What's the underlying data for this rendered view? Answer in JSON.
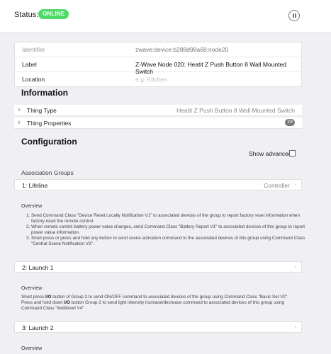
{
  "status": {
    "label": "Status:",
    "badge": "ONLINE",
    "badge_color": "#4cd964"
  },
  "pause_icon": "pause-circle-icon",
  "properties": {
    "identifier_label": "Identifier",
    "identifier_value": "zwave:device:b288d98a68:node20",
    "label_label": "Label",
    "label_value": "Z-Wave Node 020: Heatit Z Push Button 8 Wall Mounted Switch",
    "location_label": "Location",
    "location_placeholder": "e.g. Kitchen"
  },
  "information": {
    "title": "Information",
    "thing_type_label": "Thing Type",
    "thing_type_value": "Heatit Z Push Button 8 Wall Mounted Switch",
    "thing_properties_label": "Thing Properties",
    "thing_properties_count": "23"
  },
  "configuration": {
    "title": "Configuration",
    "show_advanced": "Show advanced",
    "association_groups": "Association Groups"
  },
  "groups": [
    {
      "name": "1: Lifeline",
      "value": "Controller",
      "overview_title": "Overview",
      "items": [
        "Send Command Class \"Device Reset Locally Notification V1\" to associated devices of the group to report factory reset information when factory reset the remote control.",
        "When remote control battery power value changes, send Command Class \"Battery Report V1\" to associated devices of this group to report power value information.",
        "Short press or press and hold any button to send scene activation command to the associated devices of this group using Command Class \"Central Scene Notification V3\"."
      ]
    },
    {
      "name": "2: Launch 1",
      "value": "",
      "overview_title": "Overview",
      "text_a": "Short press ",
      "bold_a": "I/O",
      "text_b": " button of Group 2 to send ON/OFF command to associated devices of the group using Command Class \"Basic Set V2\".",
      "text_c": "Press and hold down ",
      "bold_b": "I/O",
      "text_d": " button Group 2 to send light intensity increase/decrease command to associated devices of this group using Command Class \"Multilevel V4\""
    },
    {
      "name": "3: Launch 2",
      "value": "",
      "overview_title": "Overview"
    }
  ]
}
